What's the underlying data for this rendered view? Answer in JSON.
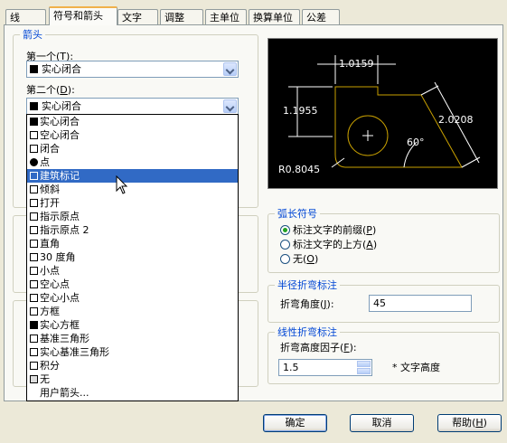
{
  "tabs": [
    "线",
    "符号和箭头",
    "文字",
    "调整",
    "主单位",
    "换算单位",
    "公差"
  ],
  "arrows": {
    "title": "箭头",
    "first_label": "第一个",
    "first_key": "T",
    "first_value": "实心闭合",
    "second_label": "第二个",
    "second_key": "D",
    "second_value": "实心闭合"
  },
  "dropdown_items": [
    "实心闭合",
    "空心闭合",
    "闭合",
    "点",
    "建筑标记",
    "倾斜",
    "打开",
    "指示原点",
    "指示原点 2",
    "直角",
    "30 度角",
    "小点",
    "空心点",
    "空心小点",
    "方框",
    "实心方框",
    "基准三角形",
    "实心基准三角形",
    "积分",
    "无",
    "用户箭头..."
  ],
  "dropdown_selected": "建筑标记",
  "preview": {
    "dim_top": "1.0159",
    "dim_left": "1.1955",
    "dim_right": "2.0208",
    "angle": "60°",
    "radius": "R0.8045"
  },
  "arc_length": {
    "title": "弧长符号",
    "options": [
      {
        "label": "标注文字的前缀",
        "key": "P"
      },
      {
        "label": "标注文字的上方",
        "key": "A"
      },
      {
        "label": "无",
        "key": "O"
      }
    ],
    "selected": 0
  },
  "radius_jog": {
    "title": "半径折弯标注",
    "angle_label": "折弯角度",
    "angle_key": "J",
    "angle_value": "45"
  },
  "linear_jog": {
    "title": "线性折弯标注",
    "height_label": "折弯高度因子",
    "height_key": "F",
    "height_value": "1.5",
    "unit_text": "* 文字高度"
  },
  "buttons": {
    "ok": "确定",
    "cancel": "取消",
    "help": "帮助",
    "help_key": "H"
  },
  "colors": {
    "accent": "#0046d5",
    "selection": "#316ac5",
    "preview_bg": "#000000",
    "preview_line": "#ffffff",
    "preview_geometry": "#c8a000"
  }
}
